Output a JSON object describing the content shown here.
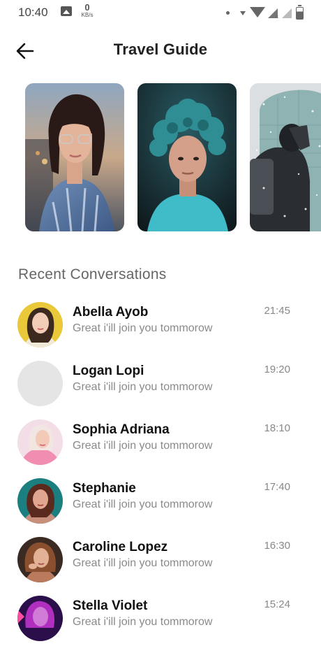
{
  "status_bar": {
    "time": "10:40",
    "speed_value": "0",
    "speed_unit": "KB/s"
  },
  "header": {
    "title": "Travel Guide",
    "back_icon": "arrow-left-icon"
  },
  "stories": [
    {
      "name": "story-woman-glasses"
    },
    {
      "name": "story-curly-hair-man"
    },
    {
      "name": "story-snow-hiker"
    }
  ],
  "section_title": "Recent Conversations",
  "conversations": [
    {
      "name": "Abella Ayob",
      "message": "Great i'ill join you tommorow",
      "time": "21:45"
    },
    {
      "name": "Logan Lopi",
      "message": "Great i'ill join you tommorow",
      "time": "19:20"
    },
    {
      "name": "Sophia Adriana",
      "message": "Great i'ill join you tommorow",
      "time": "18:10"
    },
    {
      "name": "Stephanie",
      "message": "Great i'ill join you tommorow",
      "time": "17:40"
    },
    {
      "name": "Caroline Lopez",
      "message": "Great i'ill join you tommorow",
      "time": "16:30"
    },
    {
      "name": "Stella Violet",
      "message": "Great i'ill join you tommorow",
      "time": "15:24"
    }
  ],
  "colors": {
    "text_primary": "#111111",
    "text_secondary": "#8a8a8a",
    "placeholder_avatar": "#e5e5e5"
  }
}
